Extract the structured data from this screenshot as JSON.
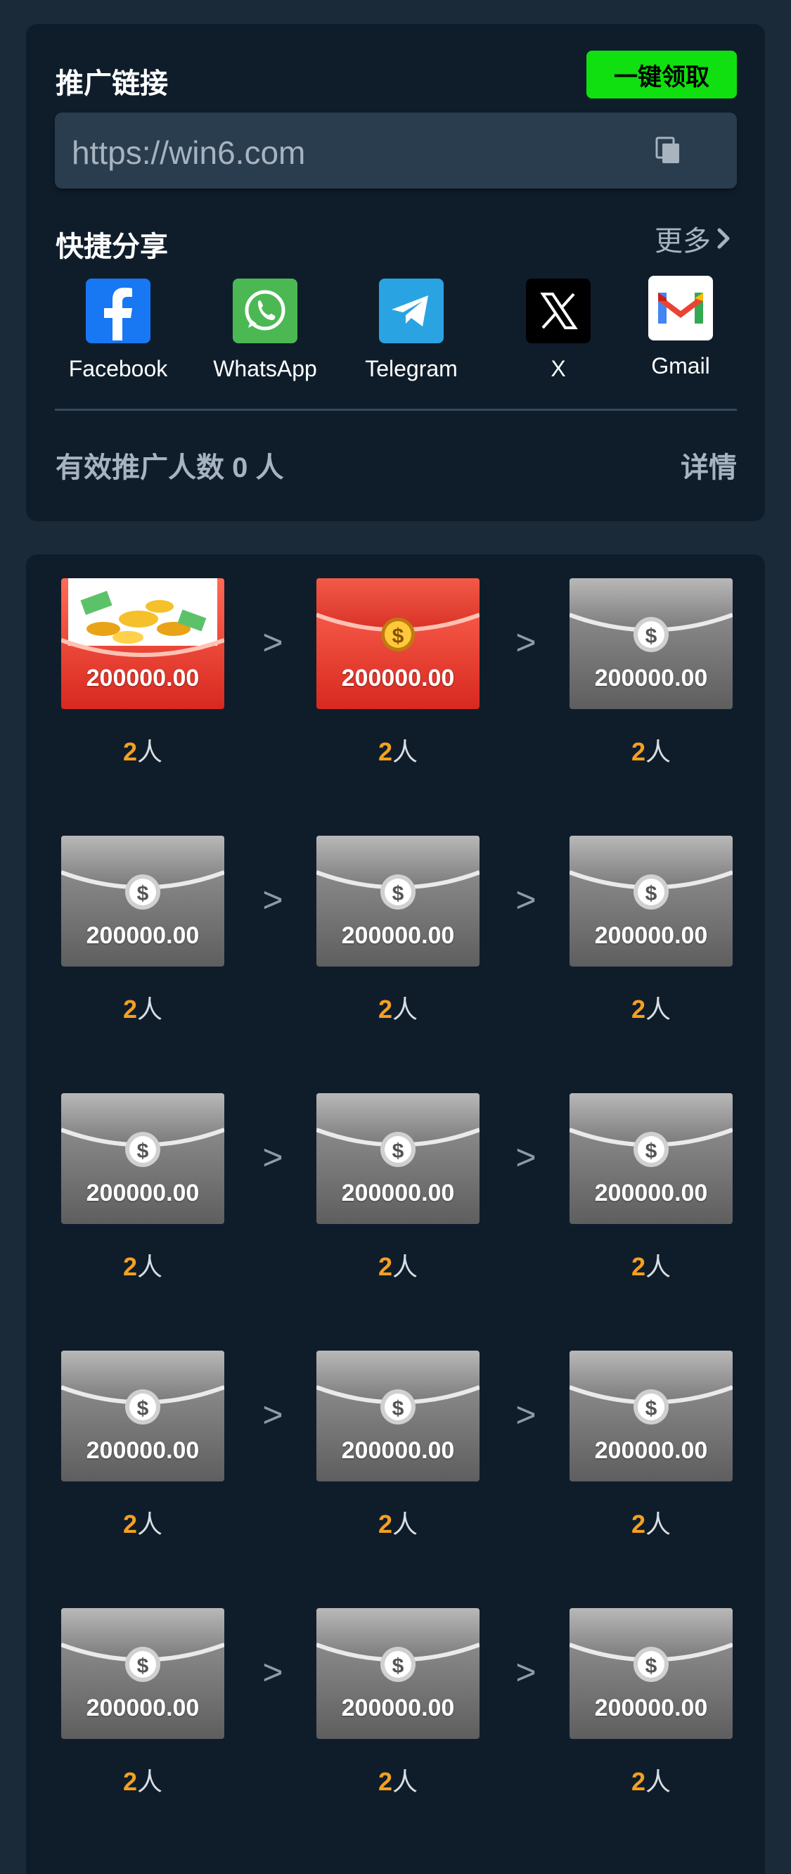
{
  "promo": {
    "title": "推广链接",
    "claim_button": "一键领取",
    "link_url": "https://win6.com",
    "copy_icon": "copy-icon"
  },
  "share": {
    "title": "快捷分享",
    "more_label": "更多",
    "items": [
      {
        "label": "Facebook",
        "icon": "facebook-icon",
        "color": "#1877f2"
      },
      {
        "label": "WhatsApp",
        "icon": "whatsapp-icon",
        "color": "#4cb853"
      },
      {
        "label": "Telegram",
        "icon": "telegram-icon",
        "color": "#2aa3e3"
      },
      {
        "label": "X",
        "icon": "x-icon",
        "color": "#000000"
      },
      {
        "label": "Gmail",
        "icon": "gmail-icon",
        "color": "#ffffff"
      }
    ]
  },
  "stats": {
    "label": "有效推广人数 0 人",
    "details_label": "详情"
  },
  "rewards": {
    "unit": "人",
    "arrow": ">",
    "items": [
      {
        "amount": "200000.00",
        "count": "2",
        "state": "open"
      },
      {
        "amount": "200000.00",
        "count": "2",
        "state": "active"
      },
      {
        "amount": "200000.00",
        "count": "2",
        "state": "locked"
      },
      {
        "amount": "200000.00",
        "count": "2",
        "state": "locked"
      },
      {
        "amount": "200000.00",
        "count": "2",
        "state": "locked"
      },
      {
        "amount": "200000.00",
        "count": "2",
        "state": "locked"
      },
      {
        "amount": "200000.00",
        "count": "2",
        "state": "locked"
      },
      {
        "amount": "200000.00",
        "count": "2",
        "state": "locked"
      },
      {
        "amount": "200000.00",
        "count": "2",
        "state": "locked"
      },
      {
        "amount": "200000.00",
        "count": "2",
        "state": "locked"
      },
      {
        "amount": "200000.00",
        "count": "2",
        "state": "locked"
      },
      {
        "amount": "200000.00",
        "count": "2",
        "state": "locked"
      },
      {
        "amount": "200000.00",
        "count": "2",
        "state": "locked"
      },
      {
        "amount": "200000.00",
        "count": "2",
        "state": "locked"
      },
      {
        "amount": "200000.00",
        "count": "2",
        "state": "locked"
      }
    ]
  },
  "colors": {
    "accent_green": "#10e010",
    "count_orange": "#f5a020",
    "card_bg": "#0f1d2b",
    "page_bg": "#1a2a38"
  }
}
